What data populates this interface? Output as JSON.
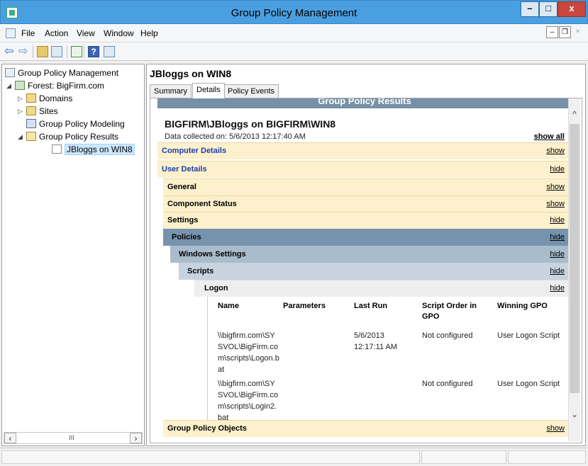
{
  "window": {
    "title": "Group Policy Management"
  },
  "menu": {
    "items": [
      "File",
      "Action",
      "View",
      "Window",
      "Help"
    ]
  },
  "toolbar": {
    "icons": [
      "back-arrow-icon",
      "forward-arrow-icon",
      "up-folder-icon",
      "show-tree-icon",
      "refresh-icon",
      "help-icon",
      "properties-icon"
    ]
  },
  "tree": {
    "root": "Group Policy Management",
    "forest": "Forest: BigFirm.com",
    "domains": "Domains",
    "sites": "Sites",
    "modeling": "Group Policy Modeling",
    "results": "Group Policy Results",
    "selected": "JBloggs on WIN8",
    "scroll_thumb": "III"
  },
  "content": {
    "title": "JBloggs on WIN8",
    "tabs": [
      "Summary",
      "Details",
      "Policy Events"
    ],
    "active_tab": "Details"
  },
  "report": {
    "header": "Group Policy Results",
    "title": "BIGFIRM\\JBloggs on BIGFIRM\\WIN8",
    "collected": "Data collected on: 5/6/2013 12:17:40 AM",
    "show_all": "show all",
    "sections": {
      "computer_details": {
        "label": "Computer Details",
        "toggle": "show"
      },
      "user_details": {
        "label": "User Details",
        "toggle": "hide"
      },
      "general": {
        "label": "General",
        "toggle": "show"
      },
      "component_status": {
        "label": "Component Status",
        "toggle": "show"
      },
      "settings": {
        "label": "Settings",
        "toggle": "hide"
      },
      "policies": {
        "label": "Policies",
        "toggle": "hide"
      },
      "windows_settings": {
        "label": "Windows Settings",
        "toggle": "hide"
      },
      "scripts": {
        "label": "Scripts",
        "toggle": "hide"
      },
      "logon": {
        "label": "Logon",
        "toggle": "hide"
      },
      "gpo": {
        "label": "Group Policy Objects",
        "toggle": "show"
      }
    },
    "logon_table": {
      "headers": [
        "Name",
        "Parameters",
        "Last Run",
        "Script Order in GPO",
        "Winning GPO"
      ],
      "rows": [
        {
          "name_lines": [
            "\\\\bigfirm.com\\SY",
            "SVOL\\BigFirm.co",
            "m\\scripts\\Logon.b",
            "at"
          ],
          "parameters": "",
          "last_run_lines": [
            "5/6/2013",
            "12:17:11 AM"
          ],
          "order": "Not configured",
          "winning_gpo": "User Logon Script"
        },
        {
          "name_lines": [
            "\\\\bigfirm.com\\SY",
            "SVOL\\BigFirm.co",
            "m\\scripts\\Login2.",
            "bat"
          ],
          "parameters": "",
          "last_run_lines": [
            "",
            ""
          ],
          "order": "Not configured",
          "winning_gpo": "User Logon Script"
        }
      ]
    }
  }
}
